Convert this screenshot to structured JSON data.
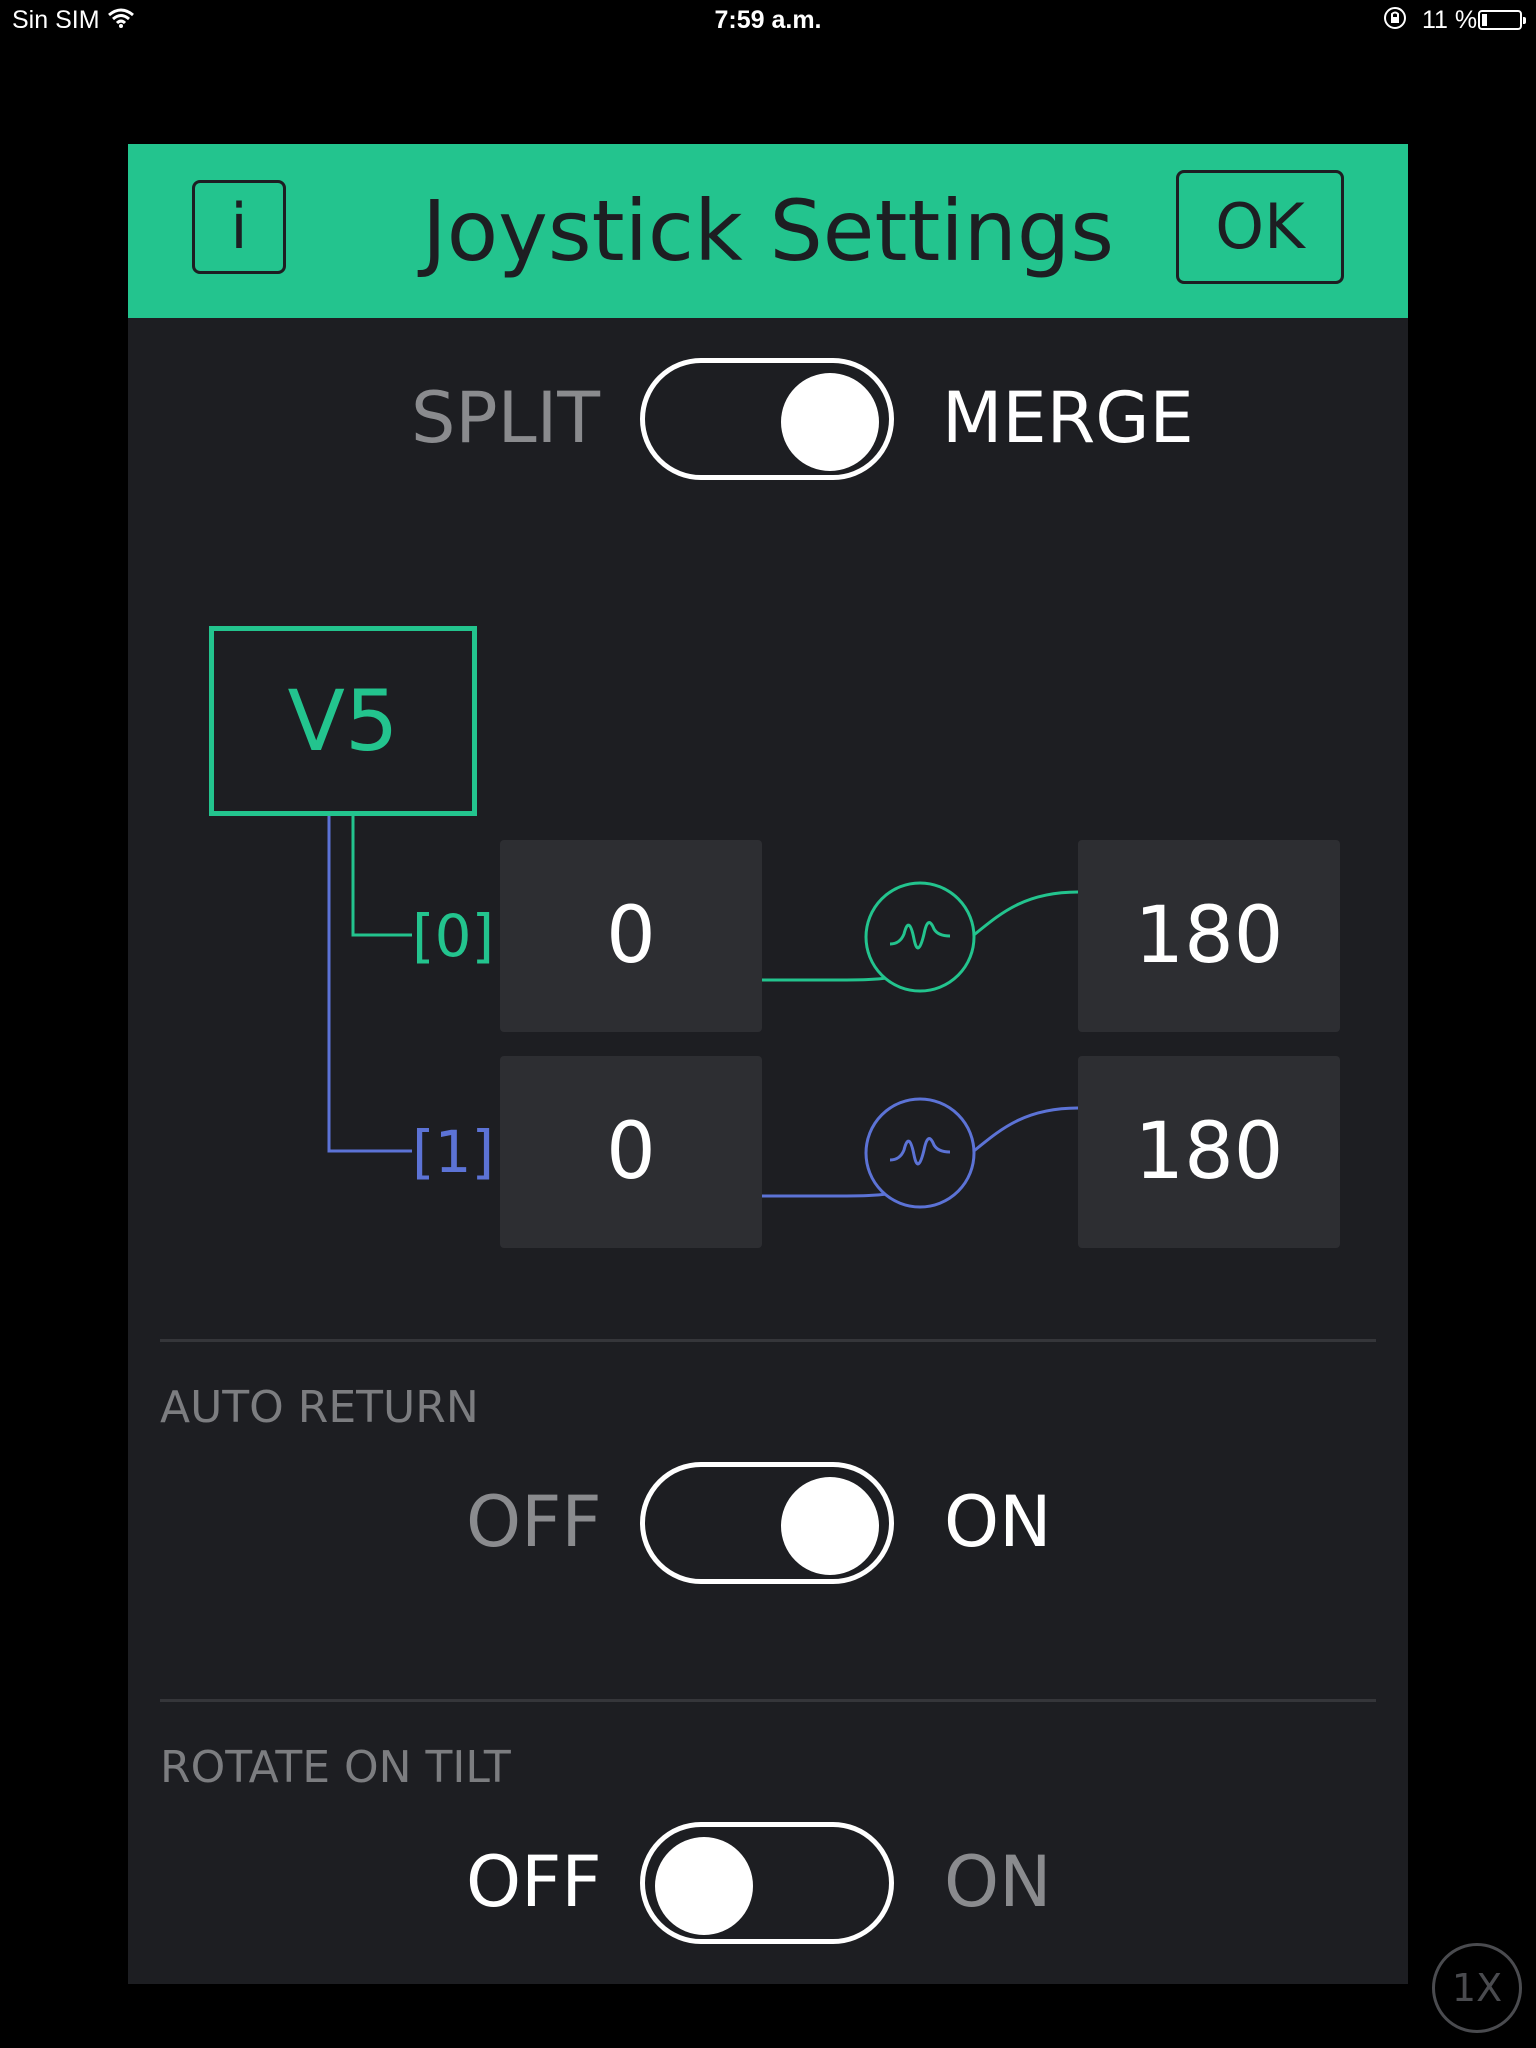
{
  "status_bar": {
    "carrier": "Sin SIM",
    "time": "7:59 a.m.",
    "battery": "11 %"
  },
  "dialog": {
    "title": "Joystick Settings",
    "info_label": "i",
    "ok_label": "OK"
  },
  "mode_toggle": {
    "left_label": "SPLIT",
    "right_label": "MERGE",
    "state": "on"
  },
  "pin": {
    "name": "V5"
  },
  "channels": [
    {
      "index_label": "[0]",
      "min": "0",
      "max": "180",
      "color": "#23c48e"
    },
    {
      "index_label": "[1]",
      "min": "0",
      "max": "180",
      "color": "#5c73d6"
    }
  ],
  "auto_return": {
    "section_label": "AUTO RETURN",
    "off_label": "OFF",
    "on_label": "ON",
    "state": "on"
  },
  "rotate_on_tilt": {
    "section_label": "ROTATE ON TILT",
    "off_label": "OFF",
    "on_label": "ON",
    "state": "off"
  },
  "speed_button": {
    "label": "1X"
  },
  "colors": {
    "accent": "#23c48e",
    "secondary": "#5c73d6",
    "background": "#1d1e22"
  }
}
